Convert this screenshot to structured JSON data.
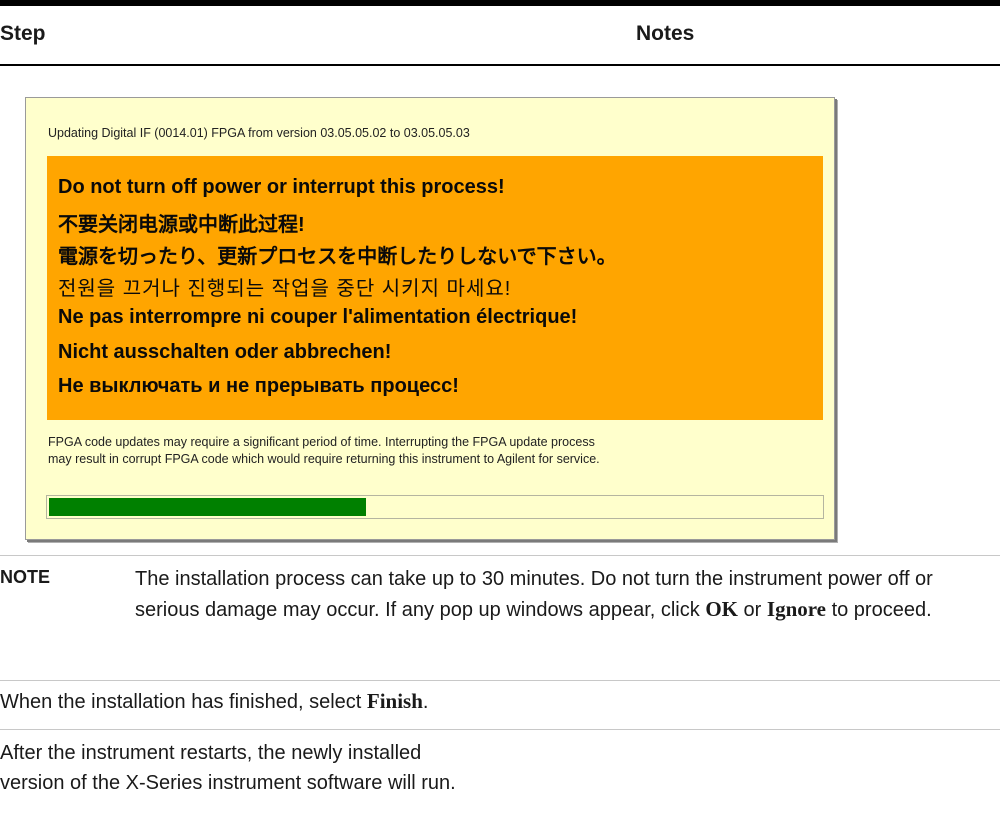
{
  "header": {
    "step_label": "Step",
    "notes_label": "Notes"
  },
  "dialog": {
    "title": "Updating Digital IF (0014.01) FPGA from version 03.05.05.02 to 03.05.05.03",
    "warnings": [
      "Do not turn off power or interrupt this process!",
      "不要关闭电源或中断此过程!",
      "電源を切ったり、更新プロセスを中断したりしないで下さい。",
      "전원을 끄거나 진행되는 작업을 중단 시키지 마세요!",
      "Ne pas interrompre ni couper l'alimentation électrique!",
      "Nicht ausschalten oder abbrechen!",
      "Не выключать и не прерывать процесс!"
    ],
    "info_line1": "FPGA code updates may require a significant period of time. Interrupting the FPGA update process",
    "info_line2": "may result in corrupt FPGA code which would require returning this instrument to Agilent for service.",
    "progress_fraction": 0.41,
    "colors": {
      "background": "#ffffcc",
      "warning": "#ffa500",
      "progress": "#008000"
    }
  },
  "note": {
    "label": "NOTE",
    "text_before_ok": "The installation process can take up to 30 minutes. Do not turn the instrument power off or serious damage may occur. If any pop up windows appear, click ",
    "ok": "OK",
    "text_or": " or ",
    "ignore": "Ignore",
    "text_after": " to proceed."
  },
  "finish": {
    "text_before": "When the installation has finished, select ",
    "key": "Finish",
    "text_after": "."
  },
  "restart": {
    "line1": "After the instrument restarts, the newly installed",
    "line2": "version of the X-Series instrument software will run."
  }
}
